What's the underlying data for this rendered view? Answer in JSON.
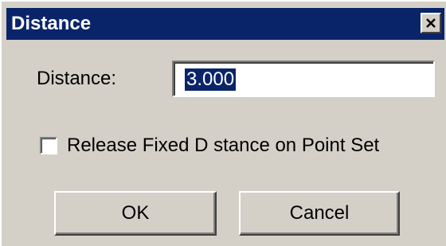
{
  "window": {
    "title": "Distance",
    "close_icon": "close-icon"
  },
  "form": {
    "distance_label": "Distance:",
    "distance_value": "3.000",
    "checkbox_label": "Release Fixed D stance on Point Set",
    "checkbox_checked": false
  },
  "buttons": {
    "ok_label": "OK",
    "cancel_label": "Cancel"
  },
  "colors": {
    "titlebar": "#0a246a",
    "face": "#d4d0c8",
    "selection": "#0a246a"
  }
}
